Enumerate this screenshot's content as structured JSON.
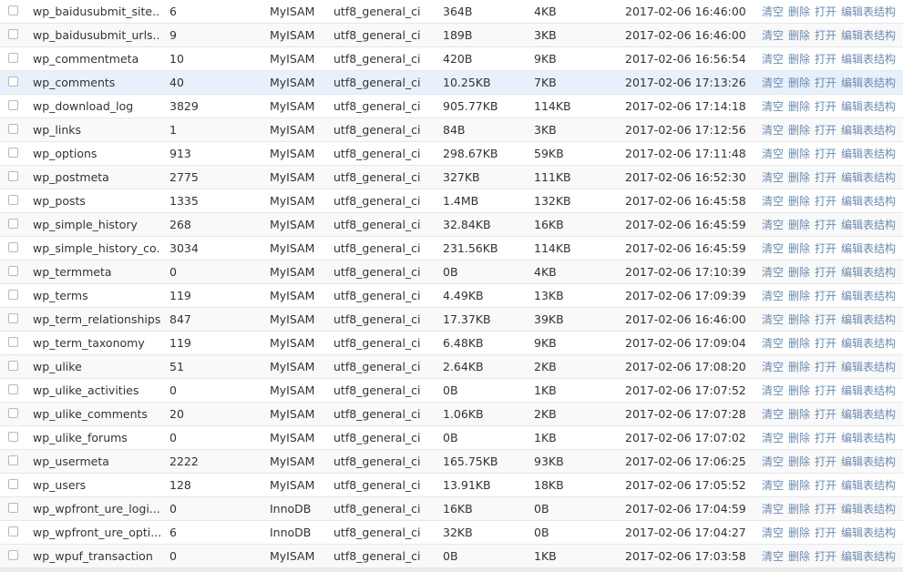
{
  "actions": {
    "clear": "清空",
    "delete": "删除",
    "open": "打开",
    "edit_structure": "编辑表结构"
  },
  "tables": [
    {
      "name": "wp_baidusubmit_site...",
      "rows": "6",
      "engine": "MyISAM",
      "collation": "utf8_general_ci",
      "data_size": "364B",
      "index_size": "4KB",
      "time": "2017-02-06 16:46:00"
    },
    {
      "name": "wp_baidusubmit_urls...",
      "rows": "9",
      "engine": "MyISAM",
      "collation": "utf8_general_ci",
      "data_size": "189B",
      "index_size": "3KB",
      "time": "2017-02-06 16:46:00"
    },
    {
      "name": "wp_commentmeta",
      "rows": "10",
      "engine": "MyISAM",
      "collation": "utf8_general_ci",
      "data_size": "420B",
      "index_size": "9KB",
      "time": "2017-02-06 16:56:54"
    },
    {
      "name": "wp_comments",
      "rows": "40",
      "engine": "MyISAM",
      "collation": "utf8_general_ci",
      "data_size": "10.25KB",
      "index_size": "7KB",
      "time": "2017-02-06 17:13:26"
    },
    {
      "name": "wp_download_log",
      "rows": "3829",
      "engine": "MyISAM",
      "collation": "utf8_general_ci",
      "data_size": "905.77KB",
      "index_size": "114KB",
      "time": "2017-02-06 17:14:18"
    },
    {
      "name": "wp_links",
      "rows": "1",
      "engine": "MyISAM",
      "collation": "utf8_general_ci",
      "data_size": "84B",
      "index_size": "3KB",
      "time": "2017-02-06 17:12:56"
    },
    {
      "name": "wp_options",
      "rows": "913",
      "engine": "MyISAM",
      "collation": "utf8_general_ci",
      "data_size": "298.67KB",
      "index_size": "59KB",
      "time": "2017-02-06 17:11:48"
    },
    {
      "name": "wp_postmeta",
      "rows": "2775",
      "engine": "MyISAM",
      "collation": "utf8_general_ci",
      "data_size": "327KB",
      "index_size": "111KB",
      "time": "2017-02-06 16:52:30"
    },
    {
      "name": "wp_posts",
      "rows": "1335",
      "engine": "MyISAM",
      "collation": "utf8_general_ci",
      "data_size": "1.4MB",
      "index_size": "132KB",
      "time": "2017-02-06 16:45:58"
    },
    {
      "name": "wp_simple_history",
      "rows": "268",
      "engine": "MyISAM",
      "collation": "utf8_general_ci",
      "data_size": "32.84KB",
      "index_size": "16KB",
      "time": "2017-02-06 16:45:59"
    },
    {
      "name": "wp_simple_history_co...",
      "rows": "3034",
      "engine": "MyISAM",
      "collation": "utf8_general_ci",
      "data_size": "231.56KB",
      "index_size": "114KB",
      "time": "2017-02-06 16:45:59"
    },
    {
      "name": "wp_termmeta",
      "rows": "0",
      "engine": "MyISAM",
      "collation": "utf8_general_ci",
      "data_size": "0B",
      "index_size": "4KB",
      "time": "2017-02-06 17:10:39"
    },
    {
      "name": "wp_terms",
      "rows": "119",
      "engine": "MyISAM",
      "collation": "utf8_general_ci",
      "data_size": "4.49KB",
      "index_size": "13KB",
      "time": "2017-02-06 17:09:39"
    },
    {
      "name": "wp_term_relationships",
      "rows": "847",
      "engine": "MyISAM",
      "collation": "utf8_general_ci",
      "data_size": "17.37KB",
      "index_size": "39KB",
      "time": "2017-02-06 16:46:00"
    },
    {
      "name": "wp_term_taxonomy",
      "rows": "119",
      "engine": "MyISAM",
      "collation": "utf8_general_ci",
      "data_size": "6.48KB",
      "index_size": "9KB",
      "time": "2017-02-06 17:09:04"
    },
    {
      "name": "wp_ulike",
      "rows": "51",
      "engine": "MyISAM",
      "collation": "utf8_general_ci",
      "data_size": "2.64KB",
      "index_size": "2KB",
      "time": "2017-02-06 17:08:20"
    },
    {
      "name": "wp_ulike_activities",
      "rows": "0",
      "engine": "MyISAM",
      "collation": "utf8_general_ci",
      "data_size": "0B",
      "index_size": "1KB",
      "time": "2017-02-06 17:07:52"
    },
    {
      "name": "wp_ulike_comments",
      "rows": "20",
      "engine": "MyISAM",
      "collation": "utf8_general_ci",
      "data_size": "1.06KB",
      "index_size": "2KB",
      "time": "2017-02-06 17:07:28"
    },
    {
      "name": "wp_ulike_forums",
      "rows": "0",
      "engine": "MyISAM",
      "collation": "utf8_general_ci",
      "data_size": "0B",
      "index_size": "1KB",
      "time": "2017-02-06 17:07:02"
    },
    {
      "name": "wp_usermeta",
      "rows": "2222",
      "engine": "MyISAM",
      "collation": "utf8_general_ci",
      "data_size": "165.75KB",
      "index_size": "93KB",
      "time": "2017-02-06 17:06:25"
    },
    {
      "name": "wp_users",
      "rows": "128",
      "engine": "MyISAM",
      "collation": "utf8_general_ci",
      "data_size": "13.91KB",
      "index_size": "18KB",
      "time": "2017-02-06 17:05:52"
    },
    {
      "name": "wp_wpfront_ure_logi...",
      "rows": "0",
      "engine": "InnoDB",
      "collation": "utf8_general_ci",
      "data_size": "16KB",
      "index_size": "0B",
      "time": "2017-02-06 17:04:59"
    },
    {
      "name": "wp_wpfront_ure_opti...",
      "rows": "6",
      "engine": "InnoDB",
      "collation": "utf8_general_ci",
      "data_size": "32KB",
      "index_size": "0B",
      "time": "2017-02-06 17:04:27"
    },
    {
      "name": "wp_wpuf_transaction",
      "rows": "0",
      "engine": "MyISAM",
      "collation": "utf8_general_ci",
      "data_size": "0B",
      "index_size": "1KB",
      "time": "2017-02-06 17:03:58"
    }
  ]
}
